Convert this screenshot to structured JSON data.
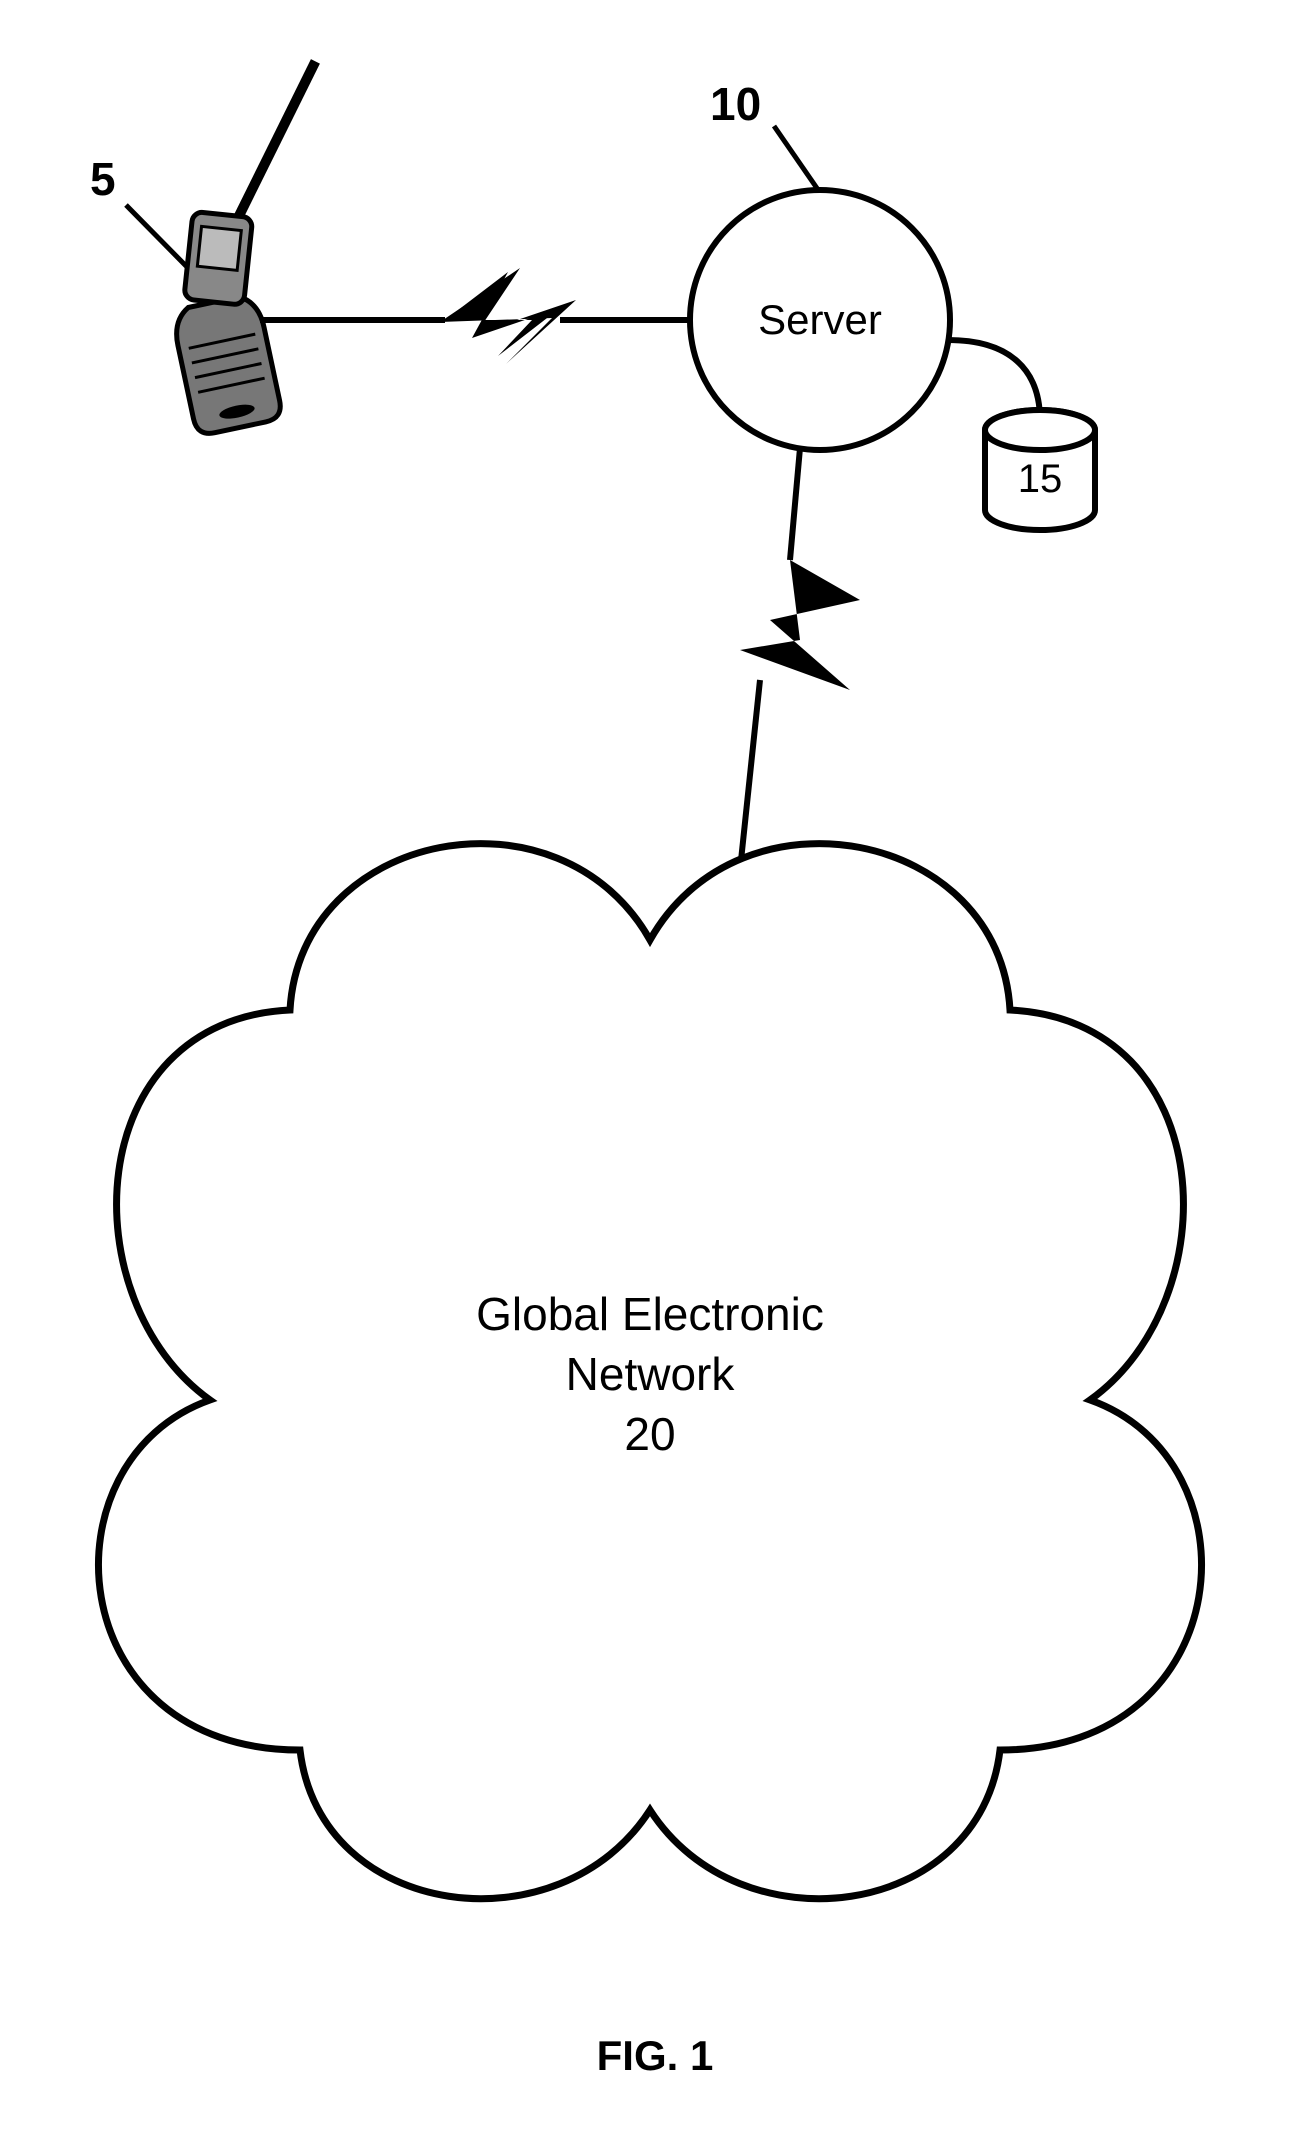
{
  "figure": {
    "caption": "FIG. 1",
    "mobile": {
      "ref": "5"
    },
    "server": {
      "ref": "10",
      "label": "Server"
    },
    "database": {
      "ref": "15"
    },
    "network": {
      "ref": "20",
      "label_line1": "Global Electronic",
      "label_line2": "Network"
    }
  }
}
